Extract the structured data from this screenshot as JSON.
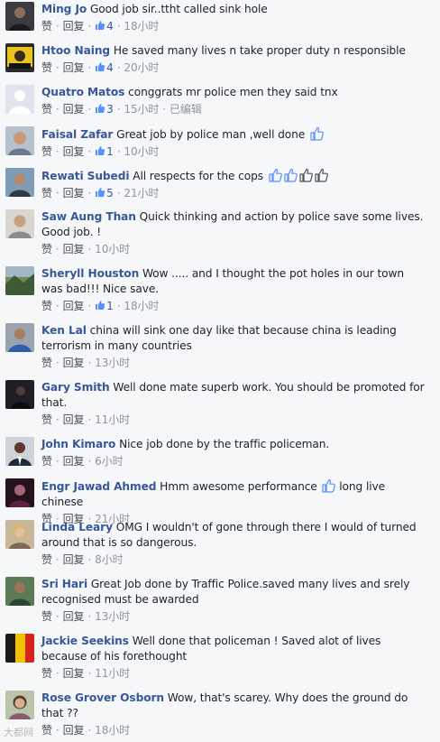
{
  "labels": {
    "like": "赞",
    "reply": "回复",
    "edited": "已编辑",
    "sep": "·"
  },
  "colors": {
    "link": "#365899",
    "meta": "#90949c",
    "text": "#1d2129",
    "background": "#f6f7f9"
  },
  "watermark": "大都网",
  "comments": [
    {
      "author": "Ming Jo",
      "text": "Good job sir..ttht called sink hole",
      "likes": "4",
      "time": "18小时",
      "avatar": "dark-portrait"
    },
    {
      "author": "Htoo Naing",
      "text": "He saved many lives n take proper duty n responsible",
      "likes": "4",
      "time": "20小时",
      "avatar": "yellow-graphic"
    },
    {
      "author": "Quatro Matos",
      "text": "conggrats mr police men they said tnx",
      "likes": "3",
      "time": "15小时",
      "edited": "已编辑",
      "avatar": "default-silhouette"
    },
    {
      "author": "Faisal Zafar",
      "text": "Great job by police man ,well done",
      "trailing_icons": [
        "thumbs-up"
      ],
      "likes": "1",
      "time": "10小时",
      "avatar": "man-portrait"
    },
    {
      "author": "Rewati Subedi",
      "text": "All respects for the cops",
      "trailing_icons": [
        "thumbs-up",
        "thumbs-up",
        "thumbs-up-dark",
        "thumbs-up-dark"
      ],
      "likes": "5",
      "time": "21小时",
      "avatar": "man-outdoor"
    },
    {
      "author": "Saw Aung Than",
      "text": "Quick thinking and action by police save some lives. Good job. !",
      "time": "10小时",
      "avatar": "man-light"
    },
    {
      "author": "Sheryll Houston",
      "text": "Wow ..... and I thought the pot holes in our town was bad!!! Nice save.",
      "likes": "1",
      "time": "18小时",
      "avatar": "landscape"
    },
    {
      "author": "Ken Lal",
      "text": "china will sink one day like that because china is leading terrorism in many countries",
      "time": "13小时",
      "avatar": "man-blue-shirt"
    },
    {
      "author": "Gary Smith",
      "text": "Well done mate superb work. You should be promoted for that.",
      "time": "11小时",
      "avatar": "dark-figure"
    },
    {
      "author": "John Kimaro",
      "text": "Nice job done by the traffic policeman.",
      "time": "6小时",
      "avatar": "man-suit"
    },
    {
      "author": "Engr Jawad Ahmed",
      "text": "Hmm awesome performance",
      "text_after_icon": "long live chinese",
      "trailing_icons": [
        "thumbs-up"
      ],
      "time": "21小时",
      "avatar": "dark-pink"
    },
    {
      "author": "Linda Leary",
      "text": "OMG I wouldn't of gone through there I would of turned around that is so dangerous.",
      "time": "8小时",
      "avatar": "woman-blonde"
    },
    {
      "author": "Sri Hari",
      "text": "Great Job done by Traffic Police.saved many lives and srely recognised must be awarded",
      "time": "13小时",
      "avatar": "man-green"
    },
    {
      "author": "Jackie Seekins",
      "text": "Well done that policeman ! Saved alot of lives because of his forethought",
      "time": "11小时",
      "avatar": "flag-stripes"
    },
    {
      "author": "Rose Grover Osborn",
      "text": "Wow, that's scarey. Why does the ground do that ??",
      "time": "18小时",
      "avatar": "woman-portrait"
    }
  ]
}
